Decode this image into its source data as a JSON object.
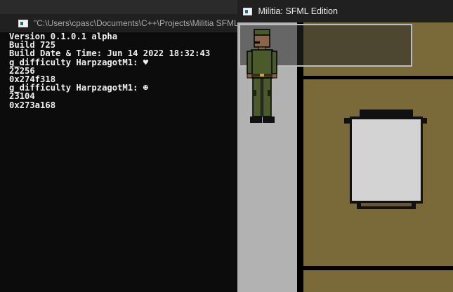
{
  "console_window": {
    "title": "\"C:\\Users\\cpasc\\Documents\\C++\\Projects\\Militia SFML",
    "lines": [
      "Version 0.1.0.1 alpha",
      "Build 725",
      "Build Date & Time: Jun 14 2022 18:32:43",
      "g_difficulty HarpzagotM1: ♥",
      "22256",
      "0x274f318",
      "g_difficulty HarpzagotM1: ☻",
      "23104",
      "0x273a168"
    ]
  },
  "game_window": {
    "title": "Militia: SFML Edition"
  },
  "colors": {
    "floor_gray": "#b2b2b2",
    "floor_olive": "#7a6a3a",
    "wall_black": "#000000",
    "uniform_green": "#4a5a2a",
    "table_top": "#d3d3d3"
  }
}
